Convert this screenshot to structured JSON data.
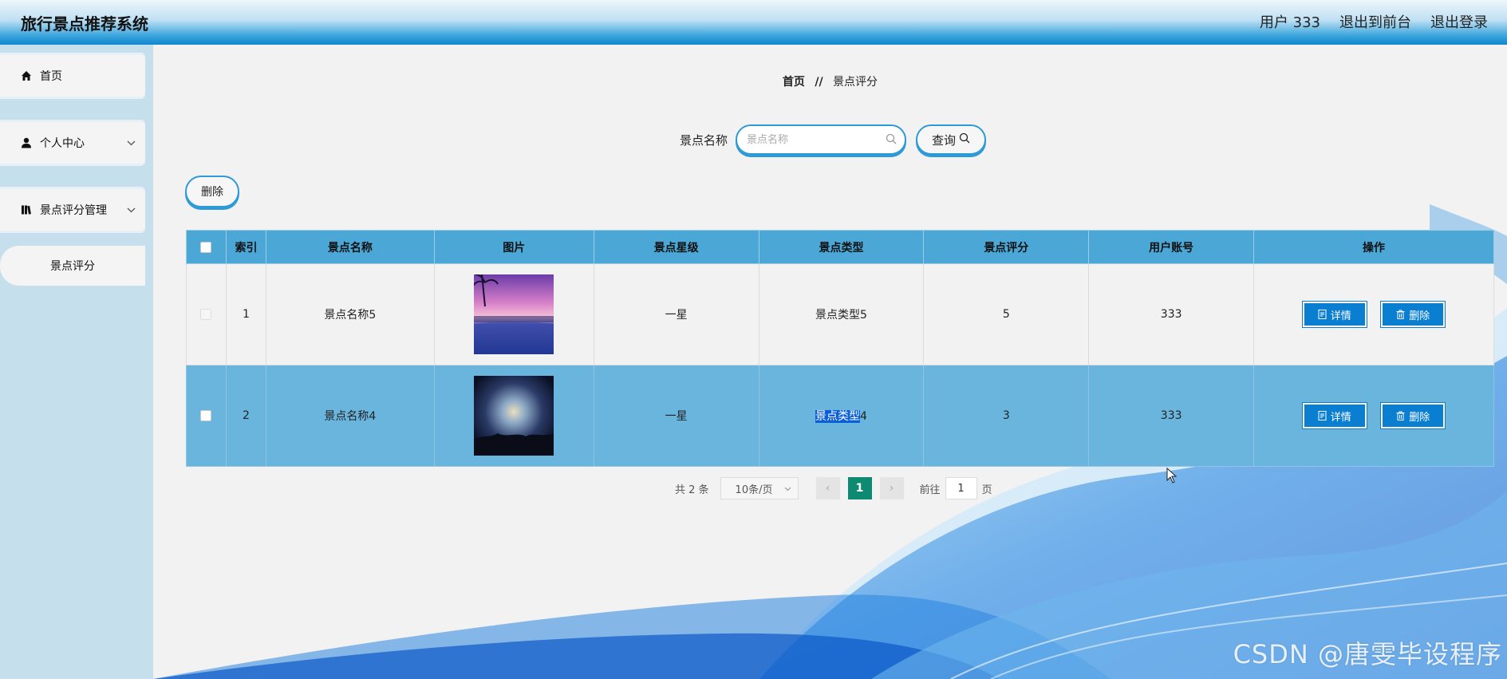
{
  "header": {
    "title": "旅行景点推荐系统",
    "user_label": "用户 333",
    "back_label": "退出到前台",
    "logout_label": "退出登录"
  },
  "sidebar": {
    "items": [
      {
        "label": "首页",
        "icon": "home-icon"
      },
      {
        "label": "个人中心",
        "icon": "user-icon"
      },
      {
        "label": "景点评分管理",
        "icon": "book-icon"
      },
      {
        "label": "景点评分"
      }
    ]
  },
  "breadcrumb": {
    "home": "首页",
    "separator": "//",
    "current": "景点评分"
  },
  "search": {
    "label": "景点名称",
    "placeholder": "景点名称",
    "button_label": "查询"
  },
  "toolbar": {
    "delete_label": "删除"
  },
  "table": {
    "headers": [
      "索引",
      "景点名称",
      "图片",
      "景点星级",
      "景点类型",
      "景点评分",
      "用户账号",
      "操作"
    ],
    "rows": [
      {
        "index": "1",
        "name": "景点名称5",
        "star": "一星",
        "type": "景点类型5",
        "score": "5",
        "account": "333",
        "image": "sunset-palm-pool-image"
      },
      {
        "index": "2",
        "name": "景点名称4",
        "star": "一星",
        "type_highlight": "景点类型",
        "type_rest": "4",
        "score": "3",
        "account": "333",
        "image": "dark-sky-image"
      }
    ],
    "detail_label": "详情",
    "delete_label": "删除"
  },
  "pagination": {
    "total": "共 2 条",
    "page_size": "10条/页",
    "current_page": "1",
    "goto_prefix": "前往",
    "goto_value": "1",
    "goto_suffix": "页"
  },
  "watermark": "CSDN @唐雯毕设程序",
  "colors": {
    "accent": "#0a7fd1",
    "table_header": "#4ba7d6",
    "selected_row": "#6ab5dd",
    "current_page": "#0e8a72",
    "sidebar": "#c5dfec"
  }
}
